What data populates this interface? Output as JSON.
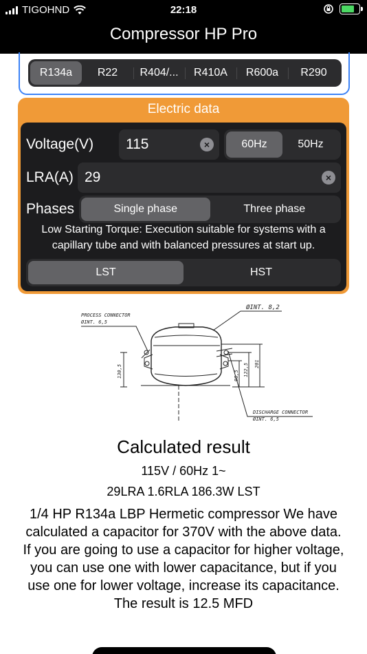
{
  "status": {
    "carrier": "TIGOHND",
    "time": "22:18"
  },
  "nav": {
    "title": "Compressor HP Pro"
  },
  "refrigerants": {
    "options": [
      "R134a",
      "R22",
      "R404/...",
      "R410A",
      "R600a",
      "R290"
    ],
    "selected": "R134a"
  },
  "electric": {
    "title": "Electric data",
    "voltage_label": "Voltage(V)",
    "voltage_value": "115",
    "freq_options": [
      "60Hz",
      "50Hz"
    ],
    "freq_selected": "60Hz",
    "lra_label": "LRA(A)",
    "lra_value": "29",
    "phases_label": "Phases",
    "phase_options": [
      "Single phase",
      "Three phase"
    ],
    "phase_selected": "Single phase",
    "note": "Low Starting Torque: Execution suitable for systems with a capillary tube and with balanced pressures at start up.",
    "torque_options": [
      "LST",
      "HST"
    ],
    "torque_selected": "LST"
  },
  "diagram": {
    "process_connector": "PROCESS CONNECTOR",
    "process_dim": "ØINT. 6,5",
    "top_dim": "ØINT. 8,2",
    "discharge_connector": "DISCHARGE CONNECTOR",
    "discharge_dim": "ØINT. 6,5",
    "dim_left": "130,5",
    "dim_r1": "98,5",
    "dim_r2": "122,5",
    "dim_r3": "201"
  },
  "result": {
    "title": "Calculated result",
    "line1": "115V / 60Hz 1~",
    "line2": "29LRA 1.6RLA 186.3W LST",
    "body": "1/4 HP R134a LBP Hermetic compressor We have calculated a capacitor for 370V with the above data. If you are going to use a capacitor for higher voltage, you can use one with lower capacitance, but if you use one for lower voltage, increase its capacitance. The result is 12.5 MFD"
  }
}
